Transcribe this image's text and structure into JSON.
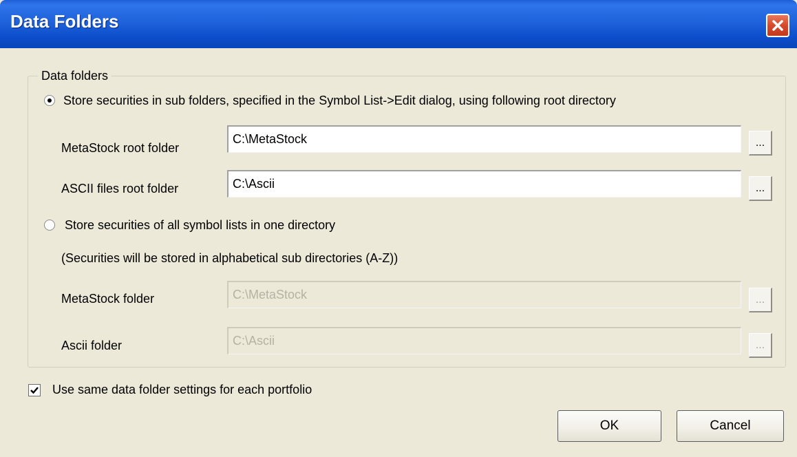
{
  "window": {
    "title": "Data Folders",
    "close_icon": "close-icon"
  },
  "group": {
    "label": "Data folders"
  },
  "option_subfolders": {
    "label": "Store securities in sub folders, specified in the Symbol List->Edit dialog, using following root directory",
    "checked": true,
    "metastock_label": "MetaStock root folder",
    "metastock_value": "C:\\MetaStock",
    "ascii_label": "ASCII files root folder",
    "ascii_value": "C:\\Ascii"
  },
  "option_one_directory": {
    "label": "Store securities of all symbol lists in one directory",
    "checked": false,
    "note": "(Securities will be stored in alphabetical sub directories (A-Z))",
    "metastock_label": "MetaStock folder",
    "metastock_value": "C:\\MetaStock",
    "ascii_label": "Ascii folder",
    "ascii_value": "C:\\Ascii"
  },
  "browse_label": "...",
  "same_settings": {
    "label": "Use same data folder settings for each portfolio",
    "checked": true
  },
  "buttons": {
    "ok": "OK",
    "cancel": "Cancel"
  }
}
